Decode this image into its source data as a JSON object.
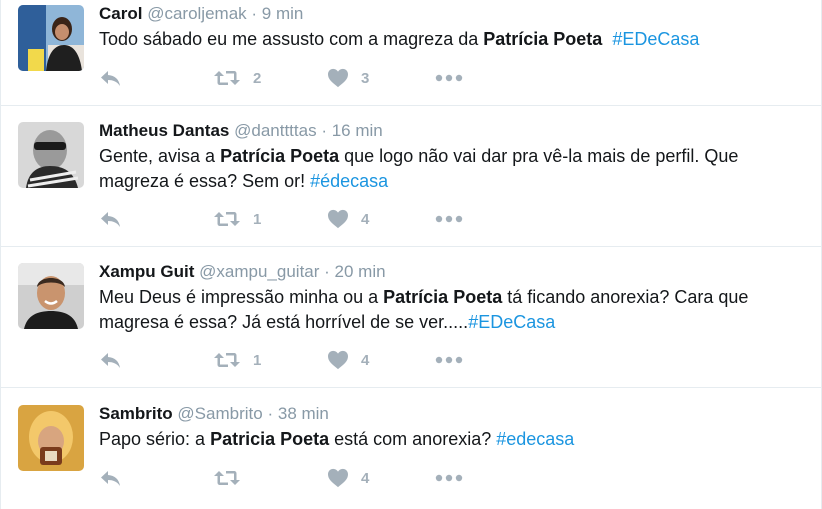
{
  "tweets": [
    {
      "name": "Carol",
      "handle": "@caroljemak",
      "sep": "·",
      "time": "9 min",
      "text_before": "Todo sábado eu me assusto com a magreza da ",
      "bold": "Patrícia Poeta",
      "text_after": "  ",
      "hashtag": "#EDeCasa",
      "retweets": "2",
      "likes": "3"
    },
    {
      "name": "Matheus Dantas",
      "handle": "@danttttas",
      "sep": "·",
      "time": "16 min",
      "text_before": "Gente, avisa a ",
      "bold": "Patrícia Poeta",
      "text_after": " que logo não vai dar pra vê-la mais de perfil. Que magreza é essa? Sem or! ",
      "hashtag": "#édecasa",
      "retweets": "1",
      "likes": "4"
    },
    {
      "name": "Xampu Guit",
      "handle": "@xampu_guitar",
      "sep": "·",
      "time": "20 min",
      "text_before": "Meu Deus é impressão minha ou a ",
      "bold": "Patrícia Poeta",
      "text_after": " tá ficando anorexia? Cara que magresa é essa? Já está horrível de se ver.....",
      "hashtag": "#EDeCasa",
      "retweets": "1",
      "likes": "4"
    },
    {
      "name": "Sambrito",
      "handle": "@Sambrito",
      "sep": "·",
      "time": "38 min",
      "text_before": "Papo sério: a ",
      "bold": "Patricia Poeta",
      "text_after": " está com anorexia? ",
      "hashtag": "#edecasa",
      "retweets": "",
      "likes": "4"
    }
  ],
  "icons": {
    "reply": "reply-icon",
    "retweet": "retweet-icon",
    "like": "heart-icon",
    "more": "more-icon"
  },
  "colors": {
    "hashtag": "#1b95e0",
    "muted": "#8899a6",
    "action": "#a4b0ba",
    "divider": "#e6ecf0"
  }
}
